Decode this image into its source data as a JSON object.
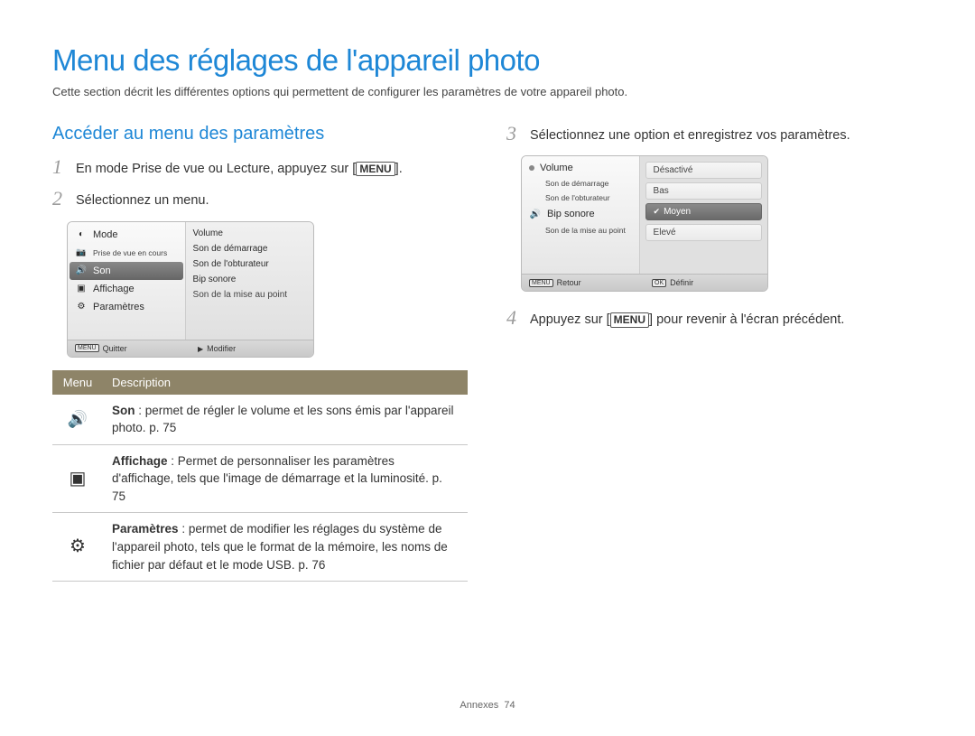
{
  "title": "Menu des réglages de l'appareil photo",
  "subtitle": "Cette section décrit les différentes options qui permettent de configurer les paramètres de votre appareil photo.",
  "section1_title": "Accéder au menu des paramètres",
  "steps": {
    "s1": {
      "num": "1",
      "pre": "En mode Prise de vue ou Lecture, appuyez sur [",
      "key": "MENU",
      "post": "]."
    },
    "s2": {
      "num": "2",
      "text": "Sélectionnez un menu."
    },
    "s3": {
      "num": "3",
      "text": "Sélectionnez une option et enregistrez vos paramètres."
    },
    "s4": {
      "num": "4",
      "pre": "Appuyez sur [",
      "key": "MENU",
      "post": "] pour revenir à l'écran précédent."
    }
  },
  "lcd1": {
    "left": {
      "mode": "Mode",
      "shoot": "Prise de vue en cours",
      "sound": "Son",
      "display": "Affichage",
      "settings": "Paramètres"
    },
    "right": {
      "r1": "Volume",
      "r2": "Son de démarrage",
      "r3": "Son de l'obturateur",
      "r4": "Bip sonore",
      "r5": "Son de la mise au point"
    },
    "foot_left_key": "MENU",
    "foot_left": "Quitter",
    "foot_right": "Modifier"
  },
  "lcd2": {
    "left": {
      "r1": "Volume",
      "r2": "Son de démarrage",
      "r3": "Son de l'obturateur",
      "r4": "Bip sonore",
      "r5": "Son de la mise au point"
    },
    "right": {
      "o1": "Désactivé",
      "o2": "Bas",
      "o3": "Moyen",
      "o4": "Elevé"
    },
    "foot_left_key": "MENU",
    "foot_left": "Retour",
    "foot_right_key": "OK",
    "foot_right": "Définir"
  },
  "table": {
    "h1": "Menu",
    "h2": "Description",
    "rows": [
      {
        "icon": "sound",
        "bold": "Son",
        "text": " : permet de régler le volume et les sons émis par l'appareil photo. p. 75"
      },
      {
        "icon": "display",
        "bold": "Affichage",
        "text": " : Permet de personnaliser les paramètres d'affichage, tels que l'image de démarrage et la luminosité. p. 75"
      },
      {
        "icon": "gear",
        "bold": "Paramètres",
        "text": " : permet de modifier les réglages du système de l'appareil photo, tels que le format de la mémoire, les noms de fichier par défaut et le mode USB. p. 76"
      }
    ]
  },
  "footer_label": "Annexes",
  "footer_page": "74"
}
